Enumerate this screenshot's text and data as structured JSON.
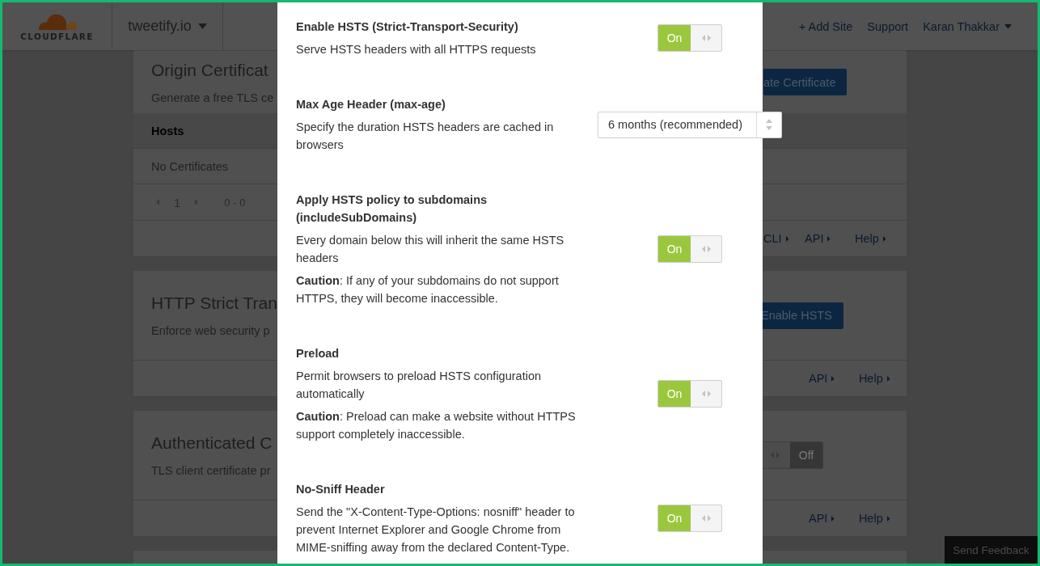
{
  "header": {
    "logo_text": "CLOUDFLARE",
    "site": "tweetify.io",
    "links": [
      "+ Add Site",
      "Support"
    ],
    "user": "Karan Thakkar"
  },
  "background_cards": [
    {
      "title": "Origin Certificat",
      "description": "Generate a free TLS ce",
      "action": "ate Certificate",
      "table": {
        "header": "Hosts",
        "empty": "No Certificates",
        "page": "1",
        "range": "0 - 0"
      },
      "footer_links": [
        "CLI",
        "API",
        "Help"
      ]
    },
    {
      "title": "HTTP Strict Tran",
      "description": "Enforce web security p",
      "action": "Enable HSTS",
      "footer_links": [
        "API",
        "Help"
      ]
    },
    {
      "title": "Authenticated C",
      "description": "TLS client certificate pr",
      "switch": {
        "on": false,
        "label": "Off"
      },
      "footer_links": [
        "API",
        "Help"
      ]
    }
  ],
  "modal": {
    "settings": [
      {
        "title": "Enable HSTS (Strict-Transport-Security)",
        "description": [
          "Serve HSTS headers with all HTTPS requests"
        ],
        "control": {
          "kind": "toggle",
          "on": true,
          "label": "On"
        }
      },
      {
        "title": "Max Age Header (max-age)",
        "description": [
          "Specify the duration HSTS headers are cached in browsers"
        ],
        "control": {
          "kind": "select",
          "value": "6 months (recommended)"
        }
      },
      {
        "title": "Apply HSTS policy to subdomains (includeSubDomains)",
        "description": [
          "Every domain below this will inherit the same HSTS headers",
          "**Caution**: If any of your subdomains do not support HTTPS, they will become inaccessible."
        ],
        "control": {
          "kind": "toggle",
          "on": true,
          "label": "On"
        }
      },
      {
        "title": "Preload",
        "description": [
          "Permit browsers to preload HSTS configuration automatically",
          "**Caution**: Preload can make a website without HTTPS support completely inaccessible."
        ],
        "control": {
          "kind": "toggle",
          "on": true,
          "label": "On"
        }
      },
      {
        "title": "No-Sniff Header",
        "description": [
          "Send the \"X-Content-Type-Options: nosniff\" header to prevent Internet Explorer and Google Chrome from MIME-sniffing away from the declared Content-Type."
        ],
        "control": {
          "kind": "toggle",
          "on": true,
          "label": "On"
        }
      }
    ]
  },
  "feedback_button": "Send Feedback"
}
